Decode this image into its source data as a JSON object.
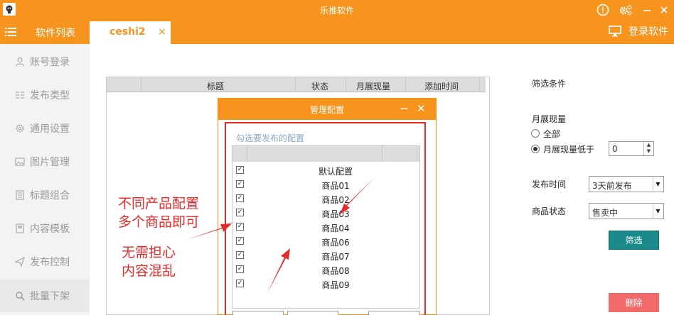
{
  "window": {
    "title": "乐推软件"
  },
  "nav": {
    "software_list_label": "软件列表",
    "active_tab_label": "ceshi2",
    "tab_close_glyph": "×",
    "login_label": "登录软件"
  },
  "sidebar": {
    "items": [
      {
        "label": "账号登录",
        "icon": "user-icon"
      },
      {
        "label": "发布类型",
        "icon": "list-icon"
      },
      {
        "label": "通用设置",
        "icon": "gear-icon"
      },
      {
        "label": "图片管理",
        "icon": "image-icon"
      },
      {
        "label": "标题组合",
        "icon": "document-icon"
      },
      {
        "label": "内容模板",
        "icon": "template-icon"
      },
      {
        "label": "发布控制",
        "icon": "send-icon"
      },
      {
        "label": "批量下架",
        "icon": "search-icon"
      }
    ]
  },
  "main_table": {
    "columns": [
      "标题",
      "状态",
      "月展现量",
      "添加时间"
    ]
  },
  "filter": {
    "title": "筛选条件",
    "monthly_views_label": "月展现量",
    "radio_all": "全部",
    "radio_below": "月展现量低于",
    "below_value": "0",
    "publish_time_label": "发布时间",
    "publish_time_value": "3天前发布",
    "status_label": "商品状态",
    "status_value": "售卖中",
    "filter_button": "筛选",
    "delete_button": "删除"
  },
  "modal": {
    "title": "管理配置",
    "hint": "勾选要发布的配置",
    "items": [
      "默认配置",
      "商品01",
      "商品02",
      "商品03",
      "商品04",
      "商品06",
      "商品07",
      "商品08",
      "商品09"
    ],
    "checked_glyph": "✓"
  },
  "annotations": {
    "line1": "不同产品配置",
    "line2": "多个商品即可",
    "line3": "无需担心",
    "line4": "内容混乱"
  },
  "colors": {
    "brand_orange": "#f7941d",
    "filter_button": "#1a8a8a",
    "delete_button": "#f06a6a",
    "annotation_red": "#e52a2a"
  }
}
